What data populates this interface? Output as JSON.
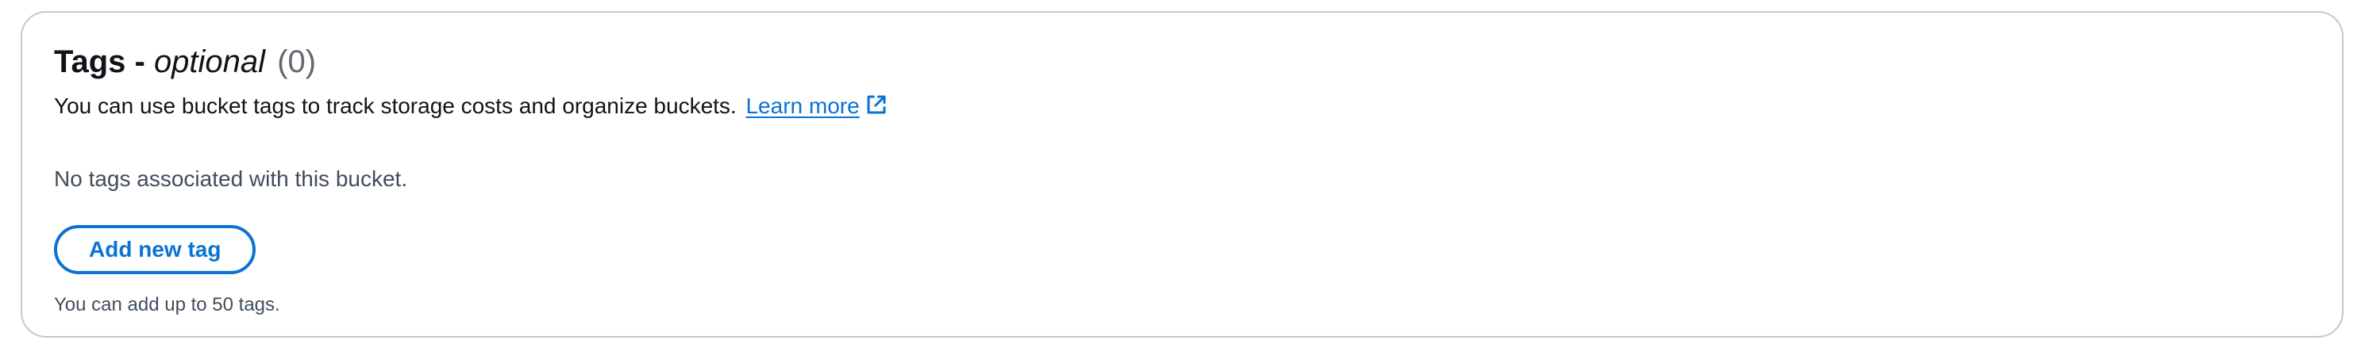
{
  "tags_panel": {
    "title_main": "Tags - ",
    "title_optional": "optional",
    "title_count": "(0)",
    "description": "You can use bucket tags to track storage costs and organize buckets.",
    "learn_more": "Learn more",
    "learn_more_icon": "external-link-icon",
    "empty_message": "No tags associated with this bucket.",
    "add_button_label": "Add new tag",
    "limit_hint": "You can add up to 50 tags."
  },
  "colors": {
    "link": "#0972d3",
    "border": "#c6c6cd",
    "text": "#0f141a",
    "secondary_text": "#414d5c"
  }
}
